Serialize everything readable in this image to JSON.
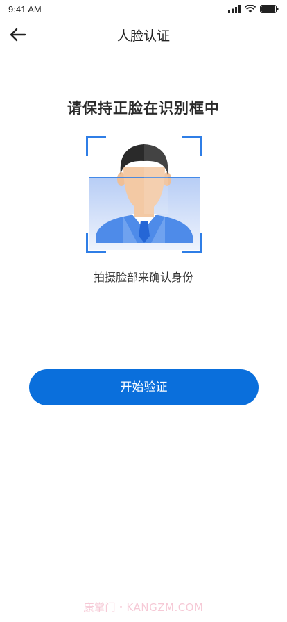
{
  "status_bar": {
    "time": "9:41 AM",
    "icons": [
      "signal-icon",
      "wifi-icon",
      "battery-icon"
    ]
  },
  "nav": {
    "back_icon": "arrow-left-icon",
    "title": "人脸认证"
  },
  "main": {
    "instruction": "请保持正脸在识别框中",
    "subtitle": "拍摄脸部来确认身份",
    "start_button_label": "开始验证"
  },
  "watermark": "康掌门・KANGZM.COM",
  "colors": {
    "accent": "#0a6fdc",
    "frame": "#2f7ee6",
    "scan_fill": "#c9d9f6",
    "suit": "#4e8be9",
    "skin": "#f3c9a4",
    "hair": "#2a2a2a"
  }
}
